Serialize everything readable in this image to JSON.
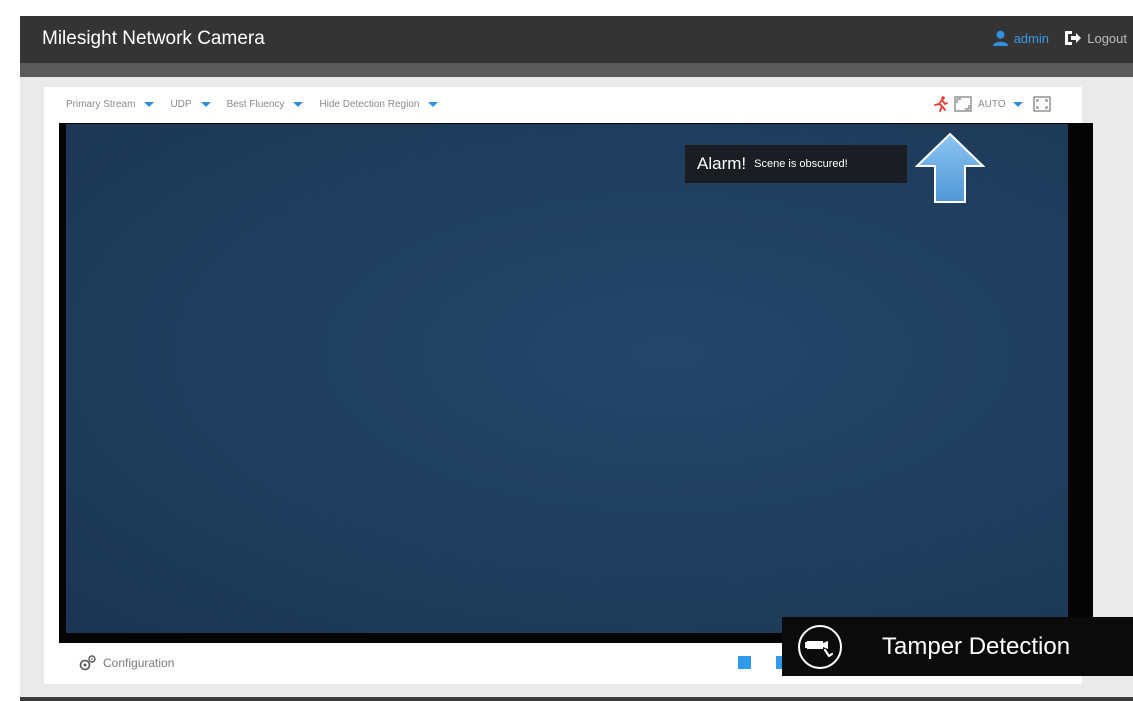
{
  "header": {
    "title": "Milesight Network Camera",
    "user": "admin",
    "logout": "Logout"
  },
  "toolbar": {
    "stream": "Primary Stream",
    "protocol": "UDP",
    "fluency": "Best Fluency",
    "detection_region": "Hide Detection Region",
    "scale_mode": "AUTO"
  },
  "alarm": {
    "title": "Alarm!",
    "message": "Scene is obscured!"
  },
  "footer": {
    "configuration": "Configuration"
  },
  "badge": {
    "label": "Tamper Detection"
  },
  "colors": {
    "accent": "#2c8fe0",
    "header_bg": "#343434",
    "video_bg": "#21405f",
    "alarm_icon": "#e53935"
  },
  "icons": {
    "user": "user-icon",
    "logout": "logout-icon",
    "alarm": "running-man-alarm-icon",
    "ratio": "aspect-ratio-icon",
    "fullscreen": "fullscreen-icon",
    "config": "gears-icon",
    "tamper": "camera-tamper-icon",
    "arrow": "arrow-up-icon"
  }
}
